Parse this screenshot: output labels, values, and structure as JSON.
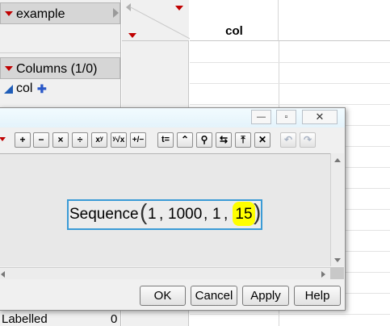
{
  "table_panel": {
    "name": "example"
  },
  "columns_panel": {
    "title": "Columns (1/0)",
    "items": [
      {
        "name": "col"
      }
    ]
  },
  "rows_panel": {
    "labelled_label": "Labelled",
    "labelled_value": "0"
  },
  "grid": {
    "column_header": "col"
  },
  "formula_dialog": {
    "window_buttons": {
      "minimize": "—",
      "restore": "▫",
      "close": "✕"
    },
    "toolbar": [
      {
        "name": "plus",
        "glyph": "+"
      },
      {
        "name": "minus",
        "glyph": "−"
      },
      {
        "name": "multiply",
        "glyph": "×"
      },
      {
        "name": "divide",
        "glyph": "÷"
      },
      {
        "name": "power",
        "glyph": "xʸ"
      },
      {
        "name": "root",
        "glyph": "ʸ√x"
      },
      {
        "name": "plus-minus",
        "glyph": "+/−"
      },
      {
        "name": "assign",
        "glyph": "t="
      },
      {
        "name": "peel",
        "glyph": "⌃"
      },
      {
        "name": "local",
        "glyph": "⚲"
      },
      {
        "name": "swap",
        "glyph": "⇆"
      },
      {
        "name": "unthrow",
        "glyph": "⤒"
      },
      {
        "name": "delete",
        "glyph": "✕"
      },
      {
        "name": "undo",
        "glyph": "↶"
      },
      {
        "name": "redo",
        "glyph": "↷"
      }
    ],
    "formula": {
      "function_name": "Sequence",
      "open_paren": "(",
      "close_paren": ")",
      "args": [
        "1",
        "1000",
        "1",
        "15"
      ],
      "separator": ",",
      "highlighted_arg_index": 3,
      "highlight_color": "#ffff00",
      "box_color": "#3b9bd6"
    },
    "buttons": {
      "ok": "OK",
      "cancel": "Cancel",
      "apply": "Apply",
      "help": "Help"
    }
  }
}
